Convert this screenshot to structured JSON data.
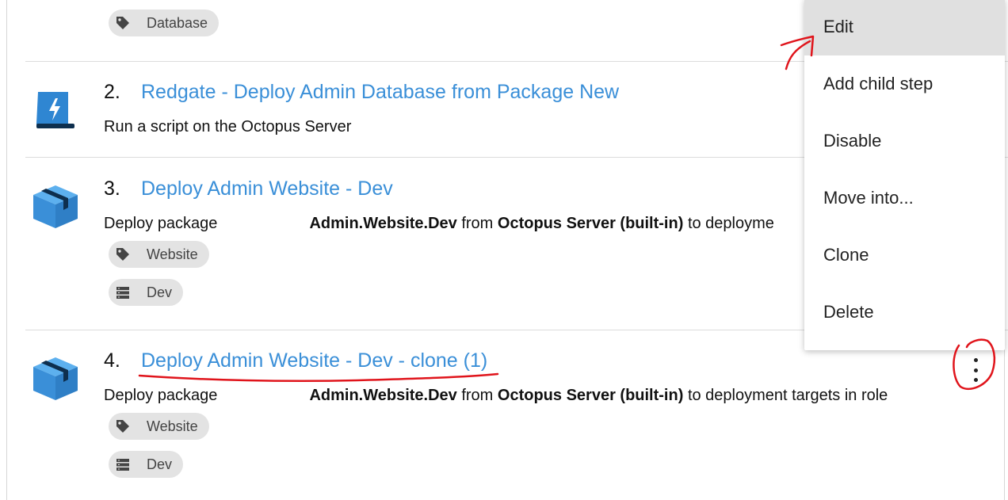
{
  "steps": [
    {
      "tags": [
        {
          "icon": "tag-icon",
          "label": "Database"
        }
      ]
    },
    {
      "number": "2.",
      "title": "Redgate - Deploy Admin Database from Package New",
      "description": "Run a script on the Octopus Server",
      "icon": "script-icon"
    },
    {
      "number": "3.",
      "title": "Deploy Admin Website - Dev",
      "description": {
        "prefix": "Deploy package",
        "package": "Admin.Website.Dev",
        "from": "from",
        "server": "Octopus Server (built-in)",
        "suffix": "to deployme"
      },
      "icon": "package-box-icon",
      "tags": [
        {
          "icon": "tag-icon",
          "label": "Website"
        },
        {
          "icon": "server-stack-icon",
          "label": "Dev"
        }
      ]
    },
    {
      "number": "4.",
      "title": "Deploy Admin Website - Dev - clone (1)",
      "description": {
        "prefix": "Deploy package",
        "package": "Admin.Website.Dev",
        "from": "from",
        "server": "Octopus Server (built-in)",
        "suffix": "to deployment targets in role"
      },
      "icon": "package-box-icon",
      "tags": [
        {
          "icon": "tag-icon",
          "label": "Website"
        },
        {
          "icon": "server-stack-icon",
          "label": "Dev"
        }
      ]
    }
  ],
  "context_menu": {
    "items": [
      "Edit",
      "Add child step",
      "Disable",
      "Move into...",
      "Clone",
      "Delete"
    ],
    "active_item": "Edit"
  },
  "colors": {
    "link": "#3a8fd8",
    "chip_bg": "#e3e3e3",
    "annotation": "#e0141b",
    "menu_active": "#e0e0e0"
  }
}
